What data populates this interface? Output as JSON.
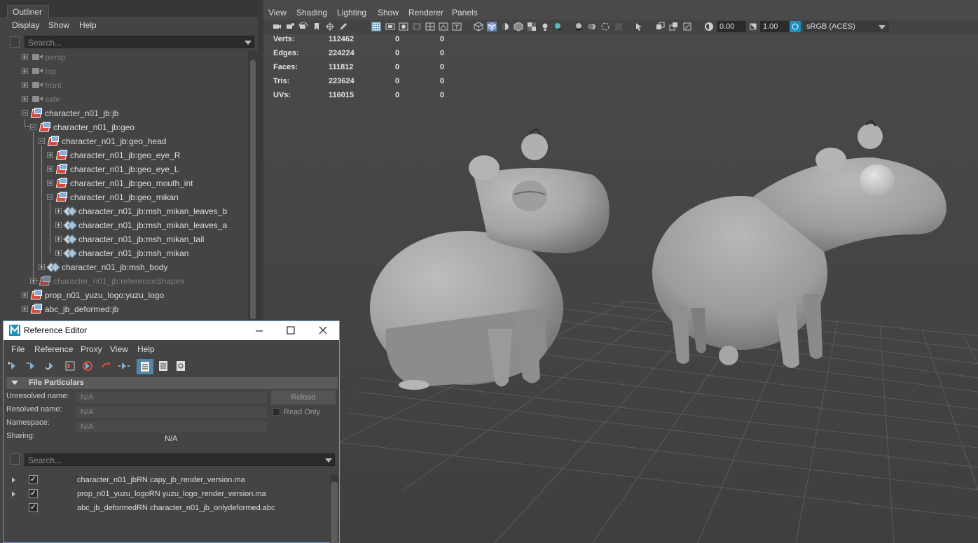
{
  "outliner": {
    "tab_label": "Outliner",
    "menu": [
      "Display",
      "Show",
      "Help"
    ],
    "search_placeholder": "Search...",
    "tree": [
      {
        "label": "persp",
        "type": "camera",
        "dim": true
      },
      {
        "label": "top",
        "type": "camera",
        "dim": true
      },
      {
        "label": "front",
        "type": "camera",
        "dim": true
      },
      {
        "label": "side",
        "type": "camera",
        "dim": true
      },
      {
        "label": "character_n01_jb:jb",
        "type": "reference"
      },
      {
        "label": "character_n01_jb:geo",
        "type": "reference"
      },
      {
        "label": "character_n01_jb:geo_head",
        "type": "reference"
      },
      {
        "label": "character_n01_jb:geo_eye_R",
        "type": "reference"
      },
      {
        "label": "character_n01_jb:geo_eye_L",
        "type": "reference"
      },
      {
        "label": "character_n01_jb:geo_mouth_int",
        "type": "reference"
      },
      {
        "label": "character_n01_jb:geo_mikan",
        "type": "reference"
      },
      {
        "label": "character_n01_jb:msh_mikan_leaves_b",
        "type": "mesh"
      },
      {
        "label": "character_n01_jb:msh_mikan_leaves_a",
        "type": "mesh"
      },
      {
        "label": "character_n01_jb:msh_mikan_tail",
        "type": "mesh"
      },
      {
        "label": "character_n01_jb:msh_mikan",
        "type": "mesh"
      },
      {
        "label": "character_n01_jb:msh_body",
        "type": "mesh"
      },
      {
        "label": "character_n01_jb:referenceShapes",
        "type": "reference",
        "dim": true
      },
      {
        "label": "prop_n01_yuzu_logo:yuzu_logo",
        "type": "reference"
      },
      {
        "label": "abc_jb_deformed:jb",
        "type": "reference"
      }
    ]
  },
  "viewport": {
    "menu": [
      "View",
      "Shading",
      "Lighting",
      "Show",
      "Renderer",
      "Panels"
    ],
    "exposure": "0.00",
    "gamma": "1.00",
    "color_space": "sRGB (ACES)",
    "hud": [
      {
        "label": "Verts:",
        "total": "112462",
        "a": "0",
        "b": "0"
      },
      {
        "label": "Edges:",
        "total": "224224",
        "a": "0",
        "b": "0"
      },
      {
        "label": "Faces:",
        "total": "111812",
        "a": "0",
        "b": "0"
      },
      {
        "label": "Tris:",
        "total": "223624",
        "a": "0",
        "b": "0"
      },
      {
        "label": "UVs:",
        "total": "116015",
        "a": "0",
        "b": "0"
      }
    ]
  },
  "reference_editor": {
    "title": "Reference Editor",
    "menu": [
      "File",
      "Reference",
      "Proxy",
      "View",
      "Help"
    ],
    "section_title": "File Particulars",
    "unresolved_label": "Unresolved name:",
    "unresolved_value": "N/A",
    "resolved_label": "Resolved name:",
    "resolved_value": "N/A",
    "namespace_label": "Namespace:",
    "namespace_value": "N/A",
    "sharing_label": "Sharing:",
    "sharing_value": "N/A",
    "reload_label": "Reload",
    "readonly_label": "Read Only",
    "search_placeholder": "Search...",
    "references": [
      {
        "label": "character_n01_jbRN capy_jb_render_version.ma",
        "checked": true,
        "expandable": true
      },
      {
        "label": "prop_n01_yuzu_logoRN yuzu_logo_render_version.ma",
        "checked": true,
        "expandable": true
      },
      {
        "label": "abc_jb_deformedRN character_n01_jb_onlydeformed.abc",
        "checked": true,
        "expandable": false
      }
    ]
  },
  "colors": {
    "panel": "#444444",
    "highlight": "#5285a6",
    "maya_logo": "#1d8fbf"
  }
}
